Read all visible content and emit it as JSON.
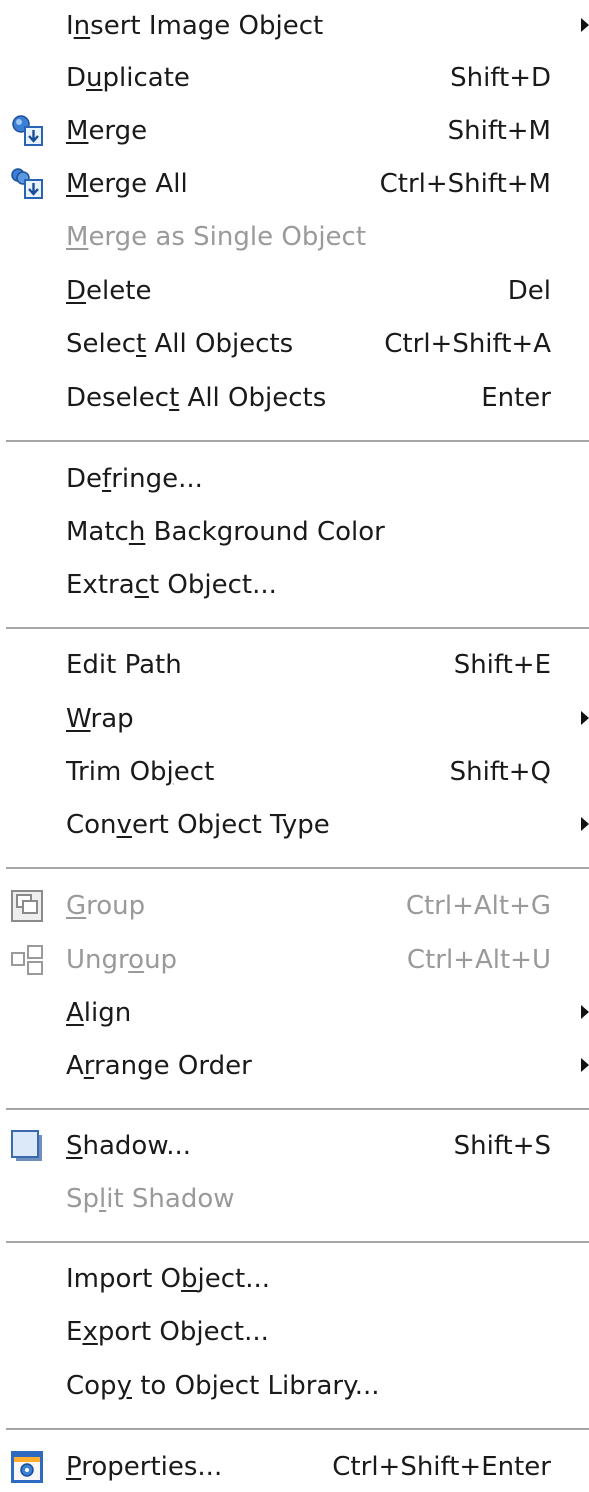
{
  "menu": {
    "items": [
      {
        "id": "insert-image-object",
        "pre": "I",
        "mn": "n",
        "post": "sert Image Object",
        "shortcut": "",
        "submenu": true,
        "disabled": false,
        "icon": ""
      },
      {
        "id": "duplicate",
        "pre": "D",
        "mn": "u",
        "post": "plicate",
        "shortcut": "Shift+D",
        "submenu": false,
        "disabled": false,
        "icon": ""
      },
      {
        "id": "merge",
        "pre": "",
        "mn": "M",
        "post": "erge",
        "shortcut": "Shift+M",
        "submenu": false,
        "disabled": false,
        "icon": "merge-icon"
      },
      {
        "id": "merge-all",
        "pre": "",
        "mn": "M",
        "post": "erge All",
        "shortcut": "Ctrl+Shift+M",
        "submenu": false,
        "disabled": false,
        "icon": "merge-all-icon"
      },
      {
        "id": "merge-as-single-object",
        "pre": "",
        "mn": "M",
        "post": "erge as Single Object",
        "shortcut": "",
        "submenu": false,
        "disabled": true,
        "icon": ""
      },
      {
        "id": "delete",
        "pre": "",
        "mn": "D",
        "post": "elete",
        "shortcut": "Del",
        "submenu": false,
        "disabled": false,
        "icon": ""
      },
      {
        "id": "select-all-objects",
        "pre": "Selec",
        "mn": "t",
        "post": " All Objects",
        "shortcut": "Ctrl+Shift+A",
        "submenu": false,
        "disabled": false,
        "icon": ""
      },
      {
        "id": "deselect-all-objects",
        "pre": "Deselec",
        "mn": "t",
        "post": " All Objects",
        "shortcut": "Enter",
        "submenu": false,
        "disabled": false,
        "icon": ""
      },
      {
        "id": "defringe",
        "pre": "De",
        "mn": "f",
        "post": "ringe...",
        "shortcut": "",
        "submenu": false,
        "disabled": false,
        "icon": ""
      },
      {
        "id": "match-background-color",
        "pre": "Matc",
        "mn": "h",
        "post": " Background Color",
        "shortcut": "",
        "submenu": false,
        "disabled": false,
        "icon": ""
      },
      {
        "id": "extract-object",
        "pre": "Extra",
        "mn": "c",
        "post": "t Object...",
        "shortcut": "",
        "submenu": false,
        "disabled": false,
        "icon": ""
      },
      {
        "id": "edit-path",
        "pre": "Edit Path",
        "mn": "",
        "post": "",
        "shortcut": "Shift+E",
        "submenu": false,
        "disabled": false,
        "icon": ""
      },
      {
        "id": "wrap",
        "pre": "",
        "mn": "W",
        "post": "rap",
        "shortcut": "",
        "submenu": true,
        "disabled": false,
        "icon": ""
      },
      {
        "id": "trim-object",
        "pre": "Trim Ob",
        "mn": "j",
        "post": "ect",
        "shortcut": "Shift+Q",
        "submenu": false,
        "disabled": false,
        "icon": ""
      },
      {
        "id": "convert-object-type",
        "pre": "Con",
        "mn": "v",
        "post": "ert Object Type",
        "shortcut": "",
        "submenu": true,
        "disabled": false,
        "icon": ""
      },
      {
        "id": "group",
        "pre": "",
        "mn": "G",
        "post": "roup",
        "shortcut": "Ctrl+Alt+G",
        "submenu": false,
        "disabled": true,
        "icon": "group-icon"
      },
      {
        "id": "ungroup",
        "pre": "Ungr",
        "mn": "o",
        "post": "up",
        "shortcut": "Ctrl+Alt+U",
        "submenu": false,
        "disabled": true,
        "icon": "ungroup-icon"
      },
      {
        "id": "align",
        "pre": "",
        "mn": "A",
        "post": "lign",
        "shortcut": "",
        "submenu": true,
        "disabled": false,
        "icon": ""
      },
      {
        "id": "arrange-order",
        "pre": "A",
        "mn": "r",
        "post": "range Order",
        "shortcut": "",
        "submenu": true,
        "disabled": false,
        "icon": ""
      },
      {
        "id": "shadow",
        "pre": "",
        "mn": "S",
        "post": "hadow...",
        "shortcut": "Shift+S",
        "submenu": false,
        "disabled": false,
        "icon": "shadow-icon"
      },
      {
        "id": "split-shadow",
        "pre": "Sp",
        "mn": "l",
        "post": "it Shadow",
        "shortcut": "",
        "submenu": false,
        "disabled": true,
        "icon": ""
      },
      {
        "id": "import-object",
        "pre": "Import O",
        "mn": "b",
        "post": "ject...",
        "shortcut": "",
        "submenu": false,
        "disabled": false,
        "icon": ""
      },
      {
        "id": "export-object",
        "pre": "E",
        "mn": "x",
        "post": "port Object...",
        "shortcut": "",
        "submenu": false,
        "disabled": false,
        "icon": ""
      },
      {
        "id": "copy-to-object-library",
        "pre": "Cop",
        "mn": "y",
        "post": " to Object Library...",
        "shortcut": "",
        "submenu": false,
        "disabled": false,
        "icon": ""
      },
      {
        "id": "properties",
        "pre": "",
        "mn": "P",
        "post": "roperties...",
        "shortcut": "Ctrl+Shift+Enter",
        "submenu": false,
        "disabled": false,
        "icon": "properties-icon"
      }
    ]
  }
}
